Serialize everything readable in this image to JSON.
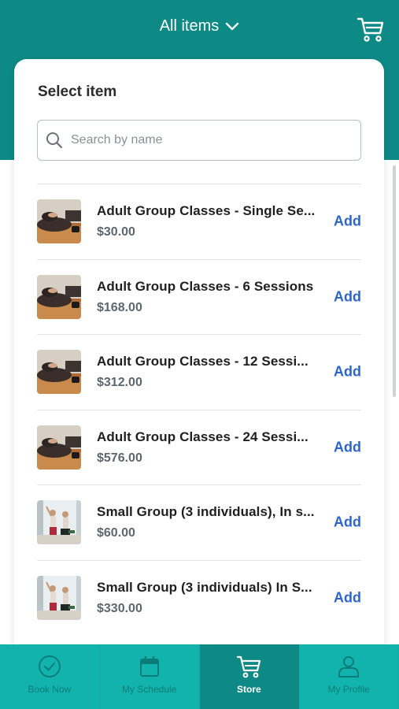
{
  "header": {
    "title": "All items",
    "chevron_icon": "chevron-down-icon",
    "cart_icon": "cart-icon",
    "background": "#0e8a86"
  },
  "panel": {
    "title": "Select item",
    "search": {
      "placeholder": "Search by name",
      "value": ""
    }
  },
  "items": [
    {
      "name": "Adult Group Classes - Single Se...",
      "price": "$30.00",
      "add_label": "Add",
      "image": "yoga-floor-photo"
    },
    {
      "name": "Adult Group Classes - 6 Sessions",
      "price": "$168.00",
      "add_label": "Add",
      "image": "yoga-floor-photo"
    },
    {
      "name": "Adult Group Classes - 12 Sessi...",
      "price": "$312.00",
      "add_label": "Add",
      "image": "yoga-floor-photo"
    },
    {
      "name": "Adult Group Classes - 24 Sessi...",
      "price": "$576.00",
      "add_label": "Add",
      "image": "yoga-floor-photo"
    },
    {
      "name": "Small Group (3 individuals), In s...",
      "price": "$60.00",
      "add_label": "Add",
      "image": "yoga-standing-photo"
    },
    {
      "name": "Small Group (3 individuals) In S...",
      "price": "$330.00",
      "add_label": "Add",
      "image": "yoga-standing-photo"
    }
  ],
  "nav": [
    {
      "label": "Book Now",
      "icon": "check-circle-icon",
      "active": false
    },
    {
      "label": "My Schedule",
      "icon": "calendar-icon",
      "active": false
    },
    {
      "label": "Store",
      "icon": "cart-icon",
      "active": true
    },
    {
      "label": "My Profile",
      "icon": "person-icon",
      "active": false
    }
  ],
  "colors": {
    "accent": "#13b3ad",
    "active_nav": "#0e8a86",
    "link": "#2d66c8"
  }
}
